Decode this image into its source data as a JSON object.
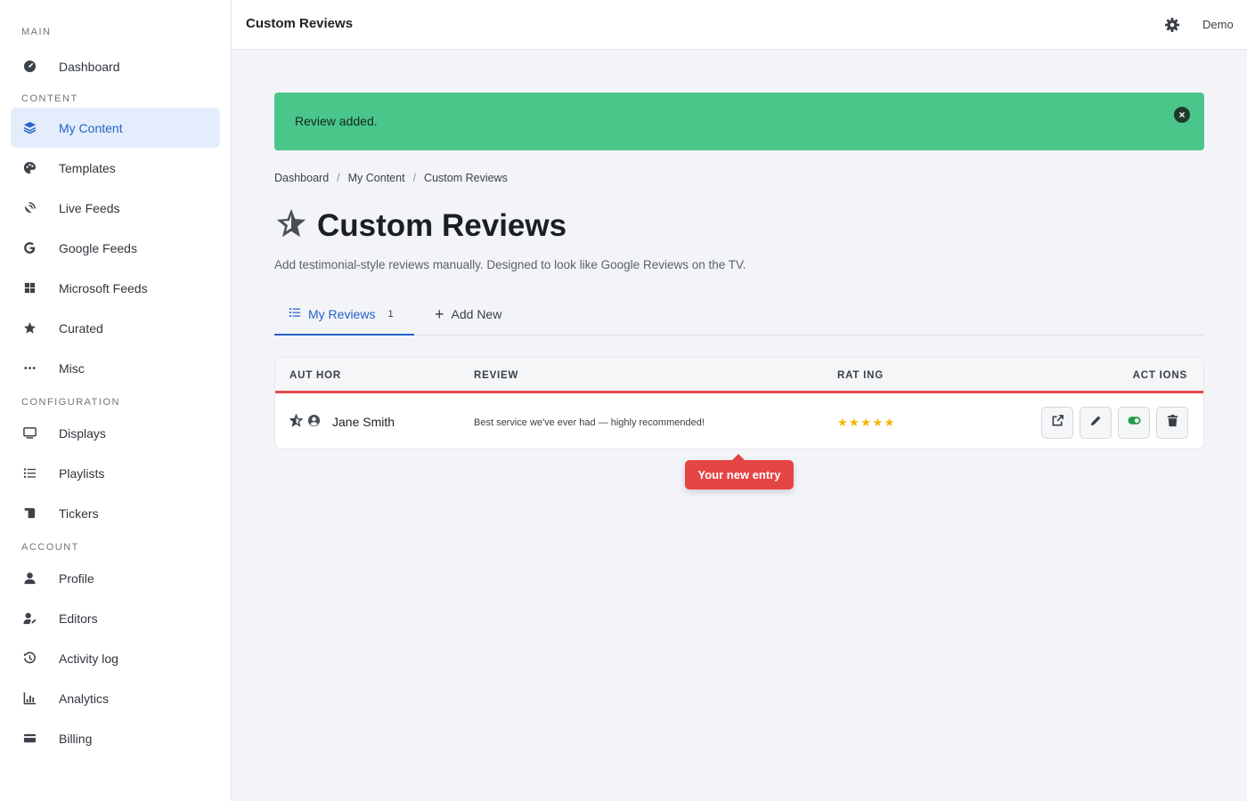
{
  "sidebar": {
    "sections": {
      "main": "MAIN",
      "content": "CONTENT",
      "configuration": "CONFIGURATION",
      "account": "ACCOUNT"
    },
    "items": {
      "dashboard": "Dashboard",
      "my_content": "My Content",
      "templates": "Templates",
      "live_feeds": "Live Feeds",
      "google_feeds": "Google Feeds",
      "microsoft_feeds": "Microsoft Feeds",
      "curated": "Curated",
      "misc": "Misc",
      "displays": "Displays",
      "playlists": "Playlists",
      "tickers": "Tickers",
      "profile": "Profile",
      "editors": "Editors",
      "activity_log": "Activity log",
      "analytics": "Analytics",
      "billing": "Billing"
    },
    "active_item": "My Content"
  },
  "topbar": {
    "title": "Custom Reviews",
    "user": "Demo",
    "settings_icon": "gear-icon"
  },
  "alert": {
    "message": "Review added.",
    "close_symbol": "×",
    "color": "#4ac68a"
  },
  "breadcrumb": {
    "items": [
      "Dashboard",
      "My Content",
      "Custom Reviews"
    ],
    "separator": "/"
  },
  "page": {
    "title": "Custom Reviews",
    "description": "Add testimonial-style reviews manually. Designed to look like Google Reviews on the TV.",
    "icon": "star-icon"
  },
  "tabs": {
    "my_reviews": {
      "label": "My Reviews",
      "count": "1"
    },
    "add_new": {
      "label": "Add New",
      "symbol": "+"
    }
  },
  "table": {
    "headers": {
      "author": "AUT HOR",
      "review": "REVIEW",
      "rating": "RAT ING",
      "actions": "ACT IONS"
    },
    "rows": [
      {
        "author": "Jane Smith",
        "review": "Best service we've ever had — highly recommended!",
        "rating": 5,
        "stars": "★★★★★"
      }
    ],
    "actions": [
      "external-link-icon",
      "pencil-icon",
      "toggle-on-icon",
      "trash-icon"
    ]
  },
  "tooltip": {
    "text": "Your new entry",
    "color": "#e64545"
  },
  "colors": {
    "accent": "#2563c9",
    "star": "#f5b400",
    "toggle_on": "#1e9c4c"
  }
}
